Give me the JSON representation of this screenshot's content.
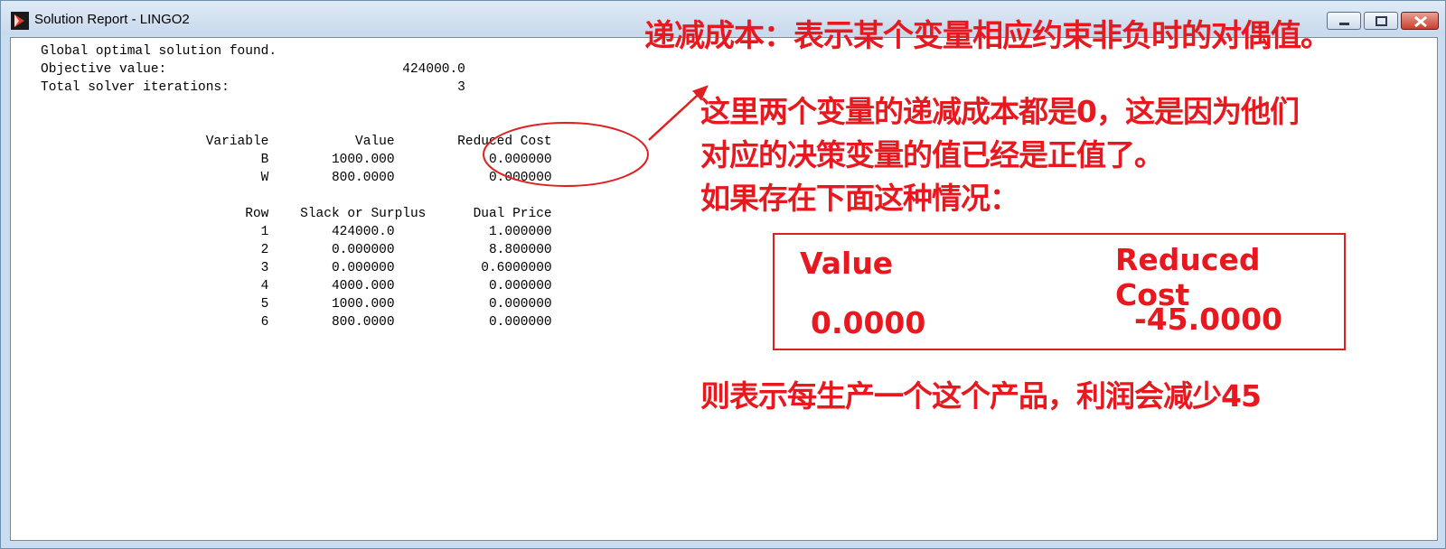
{
  "window": {
    "title": "Solution Report - LINGO2",
    "accent_color": "#c9dcf0"
  },
  "report": {
    "lines": [
      "Global optimal solution found.",
      "Objective value:                              424000.0",
      "Total solver iterations:                             3",
      "",
      "",
      "                     Variable           Value        Reduced Cost",
      "                            B        1000.000            0.000000",
      "                            W        800.0000            0.000000",
      "",
      "                          Row    Slack or Surplus      Dual Price",
      "                            1        424000.0            1.000000",
      "                            2        0.000000            8.800000",
      "                            3        0.000000           0.6000000",
      "                            4        4000.000            0.000000",
      "                            5        1000.000            0.000000",
      "                            6        800.0000            0.000000"
    ]
  },
  "annotations": {
    "color": "#e8181f",
    "note1": "递减成本：表示某个变量相应约束非负时的对偶值。",
    "note2": "这里两个变量的递减成本都是0，这是因为他们\n对应的决策变量的值已经是正值了。\n如果存在下面这种情况：",
    "example": {
      "header_value": "Value",
      "header_reduced_cost": "Reduced Cost",
      "value": "0.0000",
      "reduced_cost": "-45.0000"
    },
    "note3": "则表示每生产一个这个产品，利润会减少45"
  }
}
